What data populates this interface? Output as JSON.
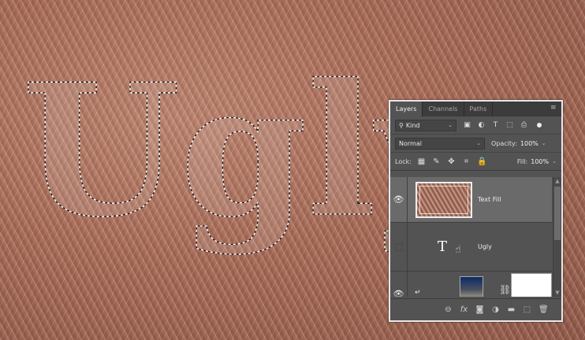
{
  "canvas": {
    "selection_text": "Ugly"
  },
  "panel": {
    "tabs": [
      "Layers",
      "Channels",
      "Paths"
    ],
    "filter": {
      "kind_label": "Kind"
    },
    "blend": {
      "mode": "Normal",
      "opacity_label": "Opacity:",
      "opacity_value": "100%"
    },
    "lock": {
      "label": "Lock:",
      "fill_label": "Fill:",
      "fill_value": "100%"
    },
    "layers": [
      {
        "name": "Text Fill",
        "visible": true,
        "selected": true
      },
      {
        "name": "Ugly",
        "visible": false,
        "type_icon": "T"
      },
      {
        "name": "",
        "visible": true
      }
    ]
  }
}
